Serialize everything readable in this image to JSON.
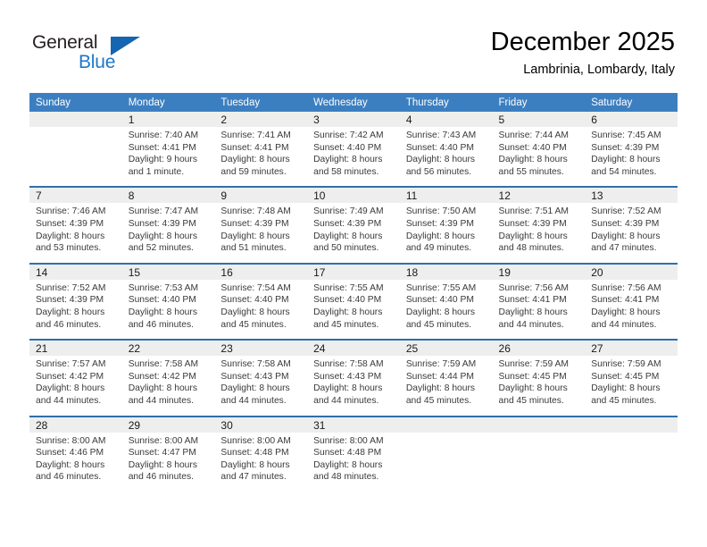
{
  "brand": {
    "name_top": "General",
    "name_bottom": "Blue",
    "color_dark": "#231f20",
    "color_blue": "#1d78c9"
  },
  "header": {
    "title": "December 2025",
    "subtitle": "Lambrinia, Lombardy, Italy"
  },
  "theme": {
    "header_row_bg": "#3c7fc1",
    "week_divider": "#2f6fab",
    "daynum_bg": "#eeeeee",
    "text": "#3a3a3a"
  },
  "calendar": {
    "weekday_headers": [
      "Sunday",
      "Monday",
      "Tuesday",
      "Wednesday",
      "Thursday",
      "Friday",
      "Saturday"
    ],
    "weeks": [
      [
        {
          "day": "",
          "sunrise": "",
          "sunset": "",
          "daylight_1": "",
          "daylight_2": "",
          "empty": true
        },
        {
          "day": "1",
          "sunrise": "Sunrise: 7:40 AM",
          "sunset": "Sunset: 4:41 PM",
          "daylight_1": "Daylight: 9 hours",
          "daylight_2": "and 1 minute."
        },
        {
          "day": "2",
          "sunrise": "Sunrise: 7:41 AM",
          "sunset": "Sunset: 4:41 PM",
          "daylight_1": "Daylight: 8 hours",
          "daylight_2": "and 59 minutes."
        },
        {
          "day": "3",
          "sunrise": "Sunrise: 7:42 AM",
          "sunset": "Sunset: 4:40 PM",
          "daylight_1": "Daylight: 8 hours",
          "daylight_2": "and 58 minutes."
        },
        {
          "day": "4",
          "sunrise": "Sunrise: 7:43 AM",
          "sunset": "Sunset: 4:40 PM",
          "daylight_1": "Daylight: 8 hours",
          "daylight_2": "and 56 minutes."
        },
        {
          "day": "5",
          "sunrise": "Sunrise: 7:44 AM",
          "sunset": "Sunset: 4:40 PM",
          "daylight_1": "Daylight: 8 hours",
          "daylight_2": "and 55 minutes."
        },
        {
          "day": "6",
          "sunrise": "Sunrise: 7:45 AM",
          "sunset": "Sunset: 4:39 PM",
          "daylight_1": "Daylight: 8 hours",
          "daylight_2": "and 54 minutes."
        }
      ],
      [
        {
          "day": "7",
          "sunrise": "Sunrise: 7:46 AM",
          "sunset": "Sunset: 4:39 PM",
          "daylight_1": "Daylight: 8 hours",
          "daylight_2": "and 53 minutes."
        },
        {
          "day": "8",
          "sunrise": "Sunrise: 7:47 AM",
          "sunset": "Sunset: 4:39 PM",
          "daylight_1": "Daylight: 8 hours",
          "daylight_2": "and 52 minutes."
        },
        {
          "day": "9",
          "sunrise": "Sunrise: 7:48 AM",
          "sunset": "Sunset: 4:39 PM",
          "daylight_1": "Daylight: 8 hours",
          "daylight_2": "and 51 minutes."
        },
        {
          "day": "10",
          "sunrise": "Sunrise: 7:49 AM",
          "sunset": "Sunset: 4:39 PM",
          "daylight_1": "Daylight: 8 hours",
          "daylight_2": "and 50 minutes."
        },
        {
          "day": "11",
          "sunrise": "Sunrise: 7:50 AM",
          "sunset": "Sunset: 4:39 PM",
          "daylight_1": "Daylight: 8 hours",
          "daylight_2": "and 49 minutes."
        },
        {
          "day": "12",
          "sunrise": "Sunrise: 7:51 AM",
          "sunset": "Sunset: 4:39 PM",
          "daylight_1": "Daylight: 8 hours",
          "daylight_2": "and 48 minutes."
        },
        {
          "day": "13",
          "sunrise": "Sunrise: 7:52 AM",
          "sunset": "Sunset: 4:39 PM",
          "daylight_1": "Daylight: 8 hours",
          "daylight_2": "and 47 minutes."
        }
      ],
      [
        {
          "day": "14",
          "sunrise": "Sunrise: 7:52 AM",
          "sunset": "Sunset: 4:39 PM",
          "daylight_1": "Daylight: 8 hours",
          "daylight_2": "and 46 minutes."
        },
        {
          "day": "15",
          "sunrise": "Sunrise: 7:53 AM",
          "sunset": "Sunset: 4:40 PM",
          "daylight_1": "Daylight: 8 hours",
          "daylight_2": "and 46 minutes."
        },
        {
          "day": "16",
          "sunrise": "Sunrise: 7:54 AM",
          "sunset": "Sunset: 4:40 PM",
          "daylight_1": "Daylight: 8 hours",
          "daylight_2": "and 45 minutes."
        },
        {
          "day": "17",
          "sunrise": "Sunrise: 7:55 AM",
          "sunset": "Sunset: 4:40 PM",
          "daylight_1": "Daylight: 8 hours",
          "daylight_2": "and 45 minutes."
        },
        {
          "day": "18",
          "sunrise": "Sunrise: 7:55 AM",
          "sunset": "Sunset: 4:40 PM",
          "daylight_1": "Daylight: 8 hours",
          "daylight_2": "and 45 minutes."
        },
        {
          "day": "19",
          "sunrise": "Sunrise: 7:56 AM",
          "sunset": "Sunset: 4:41 PM",
          "daylight_1": "Daylight: 8 hours",
          "daylight_2": "and 44 minutes."
        },
        {
          "day": "20",
          "sunrise": "Sunrise: 7:56 AM",
          "sunset": "Sunset: 4:41 PM",
          "daylight_1": "Daylight: 8 hours",
          "daylight_2": "and 44 minutes."
        }
      ],
      [
        {
          "day": "21",
          "sunrise": "Sunrise: 7:57 AM",
          "sunset": "Sunset: 4:42 PM",
          "daylight_1": "Daylight: 8 hours",
          "daylight_2": "and 44 minutes."
        },
        {
          "day": "22",
          "sunrise": "Sunrise: 7:58 AM",
          "sunset": "Sunset: 4:42 PM",
          "daylight_1": "Daylight: 8 hours",
          "daylight_2": "and 44 minutes."
        },
        {
          "day": "23",
          "sunrise": "Sunrise: 7:58 AM",
          "sunset": "Sunset: 4:43 PM",
          "daylight_1": "Daylight: 8 hours",
          "daylight_2": "and 44 minutes."
        },
        {
          "day": "24",
          "sunrise": "Sunrise: 7:58 AM",
          "sunset": "Sunset: 4:43 PM",
          "daylight_1": "Daylight: 8 hours",
          "daylight_2": "and 44 minutes."
        },
        {
          "day": "25",
          "sunrise": "Sunrise: 7:59 AM",
          "sunset": "Sunset: 4:44 PM",
          "daylight_1": "Daylight: 8 hours",
          "daylight_2": "and 45 minutes."
        },
        {
          "day": "26",
          "sunrise": "Sunrise: 7:59 AM",
          "sunset": "Sunset: 4:45 PM",
          "daylight_1": "Daylight: 8 hours",
          "daylight_2": "and 45 minutes."
        },
        {
          "day": "27",
          "sunrise": "Sunrise: 7:59 AM",
          "sunset": "Sunset: 4:45 PM",
          "daylight_1": "Daylight: 8 hours",
          "daylight_2": "and 45 minutes."
        }
      ],
      [
        {
          "day": "28",
          "sunrise": "Sunrise: 8:00 AM",
          "sunset": "Sunset: 4:46 PM",
          "daylight_1": "Daylight: 8 hours",
          "daylight_2": "and 46 minutes."
        },
        {
          "day": "29",
          "sunrise": "Sunrise: 8:00 AM",
          "sunset": "Sunset: 4:47 PM",
          "daylight_1": "Daylight: 8 hours",
          "daylight_2": "and 46 minutes."
        },
        {
          "day": "30",
          "sunrise": "Sunrise: 8:00 AM",
          "sunset": "Sunset: 4:48 PM",
          "daylight_1": "Daylight: 8 hours",
          "daylight_2": "and 47 minutes."
        },
        {
          "day": "31",
          "sunrise": "Sunrise: 8:00 AM",
          "sunset": "Sunset: 4:48 PM",
          "daylight_1": "Daylight: 8 hours",
          "daylight_2": "and 48 minutes."
        },
        {
          "day": "",
          "sunrise": "",
          "sunset": "",
          "daylight_1": "",
          "daylight_2": "",
          "empty": true
        },
        {
          "day": "",
          "sunrise": "",
          "sunset": "",
          "daylight_1": "",
          "daylight_2": "",
          "empty": true
        },
        {
          "day": "",
          "sunrise": "",
          "sunset": "",
          "daylight_1": "",
          "daylight_2": "",
          "empty": true
        }
      ]
    ]
  }
}
